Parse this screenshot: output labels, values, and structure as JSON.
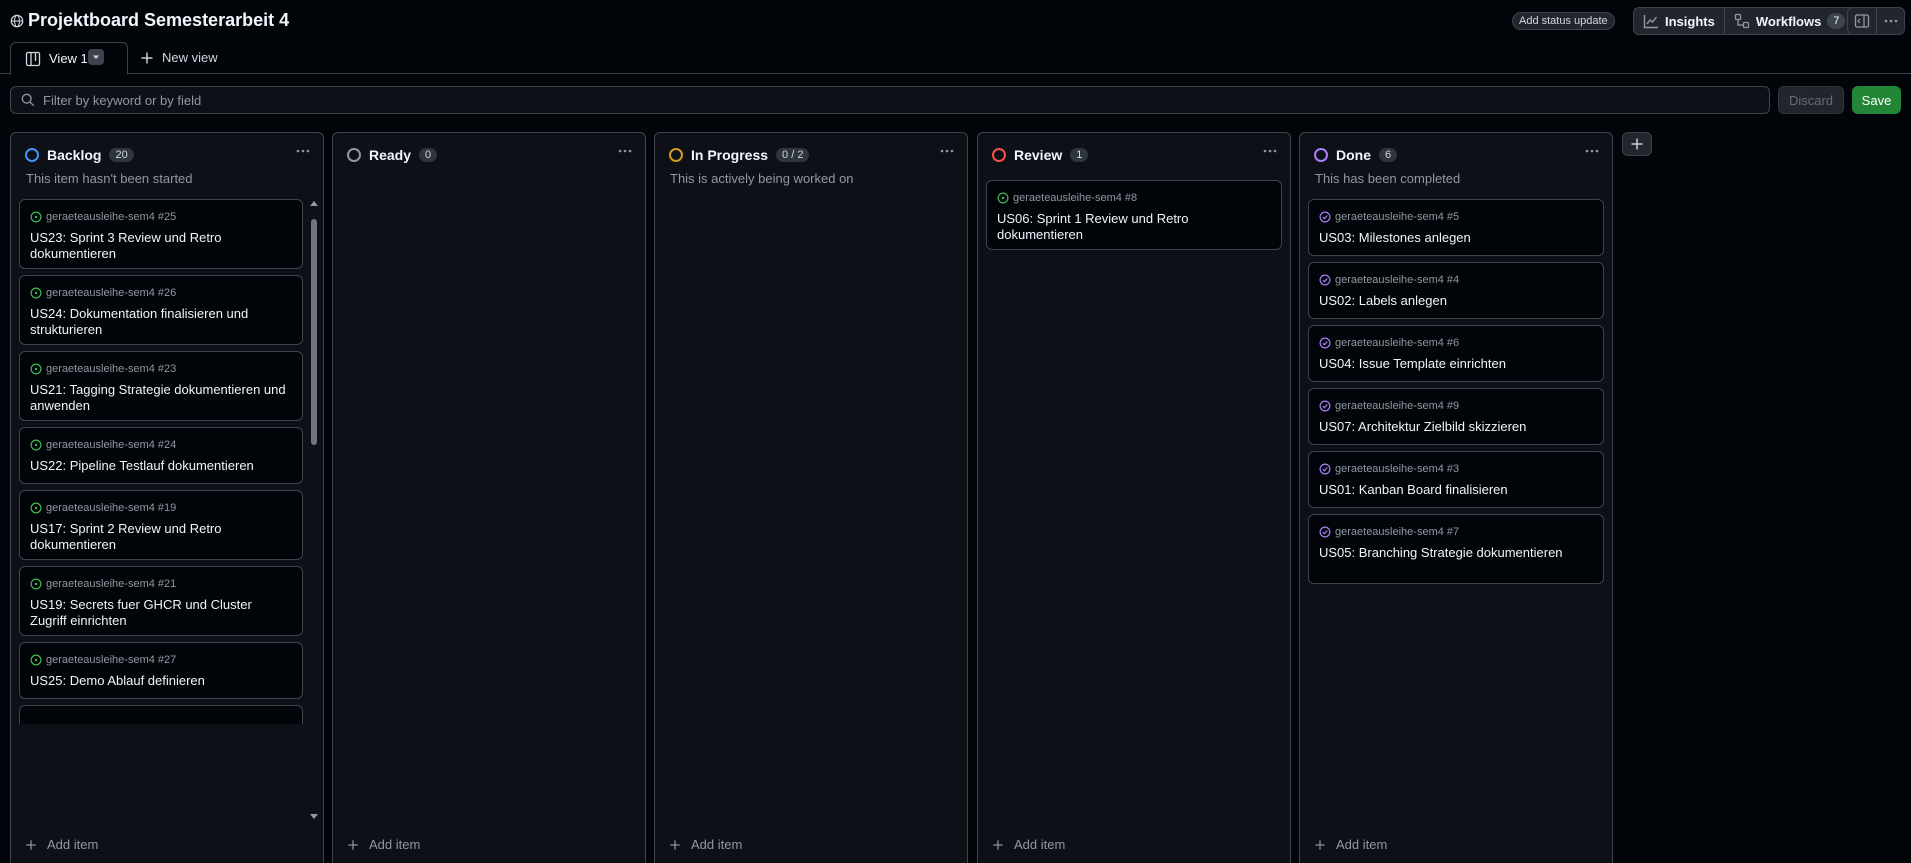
{
  "header": {
    "title": "Projektboard Semesterarbeit 4",
    "status_update": "Add status update",
    "insights": "Insights",
    "workflows": "Workflows",
    "workflows_count": "7"
  },
  "tabs": {
    "view1": "View 1",
    "new_view": "New view"
  },
  "filter": {
    "placeholder": "Filter by keyword or by field"
  },
  "actions": {
    "discard": "Discard",
    "save": "Save"
  },
  "columns": [
    {
      "name": "Backlog",
      "count": "20",
      "description": "This item hasn't been started",
      "color": "#4493f8",
      "add_label": "Add item",
      "cards": [
        {
          "repo": "geraeteausleihe-sem4 #25",
          "title": "US23: Sprint 3 Review und Retro dokumentieren"
        },
        {
          "repo": "geraeteausleihe-sem4 #26",
          "title": "US24: Dokumentation finalisieren und strukturieren"
        },
        {
          "repo": "geraeteausleihe-sem4 #23",
          "title": "US21: Tagging Strategie dokumentieren und anwenden"
        },
        {
          "repo": "geraeteausleihe-sem4 #24",
          "title": "US22: Pipeline Testlauf dokumentieren"
        },
        {
          "repo": "geraeteausleihe-sem4 #19",
          "title": "US17: Sprint 2 Review und Retro dokumentieren"
        },
        {
          "repo": "geraeteausleihe-sem4 #21",
          "title": "US19: Secrets fuer GHCR und Cluster Zugriff einrichten"
        },
        {
          "repo": "geraeteausleihe-sem4 #27",
          "title": "US25: Demo Ablauf definieren"
        }
      ]
    },
    {
      "name": "Ready",
      "count": "0",
      "description": "",
      "color": "#9198a1",
      "add_label": "Add item",
      "cards": []
    },
    {
      "name": "In Progress",
      "count": "0 / 2",
      "description": "This is actively being worked on",
      "color": "#d29922",
      "add_label": "Add item",
      "cards": []
    },
    {
      "name": "Review",
      "count": "1",
      "description": "",
      "color": "#f85149",
      "add_label": "Add item",
      "cards": [
        {
          "repo": "geraeteausleihe-sem4 #8",
          "title": "US06: Sprint 1 Review und Retro dokumentieren"
        }
      ]
    },
    {
      "name": "Done",
      "count": "6",
      "description": "This has been completed",
      "color": "#ab7df8",
      "add_label": "Add item",
      "cards": [
        {
          "repo": "geraeteausleihe-sem4 #5",
          "title": "US03: Milestones anlegen"
        },
        {
          "repo": "geraeteausleihe-sem4 #4",
          "title": "US02: Labels anlegen"
        },
        {
          "repo": "geraeteausleihe-sem4 #6",
          "title": "US04: Issue Template einrichten"
        },
        {
          "repo": "geraeteausleihe-sem4 #9",
          "title": "US07: Architektur Zielbild skizzieren"
        },
        {
          "repo": "geraeteausleihe-sem4 #3",
          "title": "US01: Kanban Board finalisieren"
        },
        {
          "repo": "geraeteausleihe-sem4 #7",
          "title": "US05: Branching Strategie dokumentieren"
        }
      ]
    }
  ],
  "colors": {
    "open_issue": "#3fb950",
    "done_issue": "#ab7df8",
    "save_green": "#238636"
  }
}
